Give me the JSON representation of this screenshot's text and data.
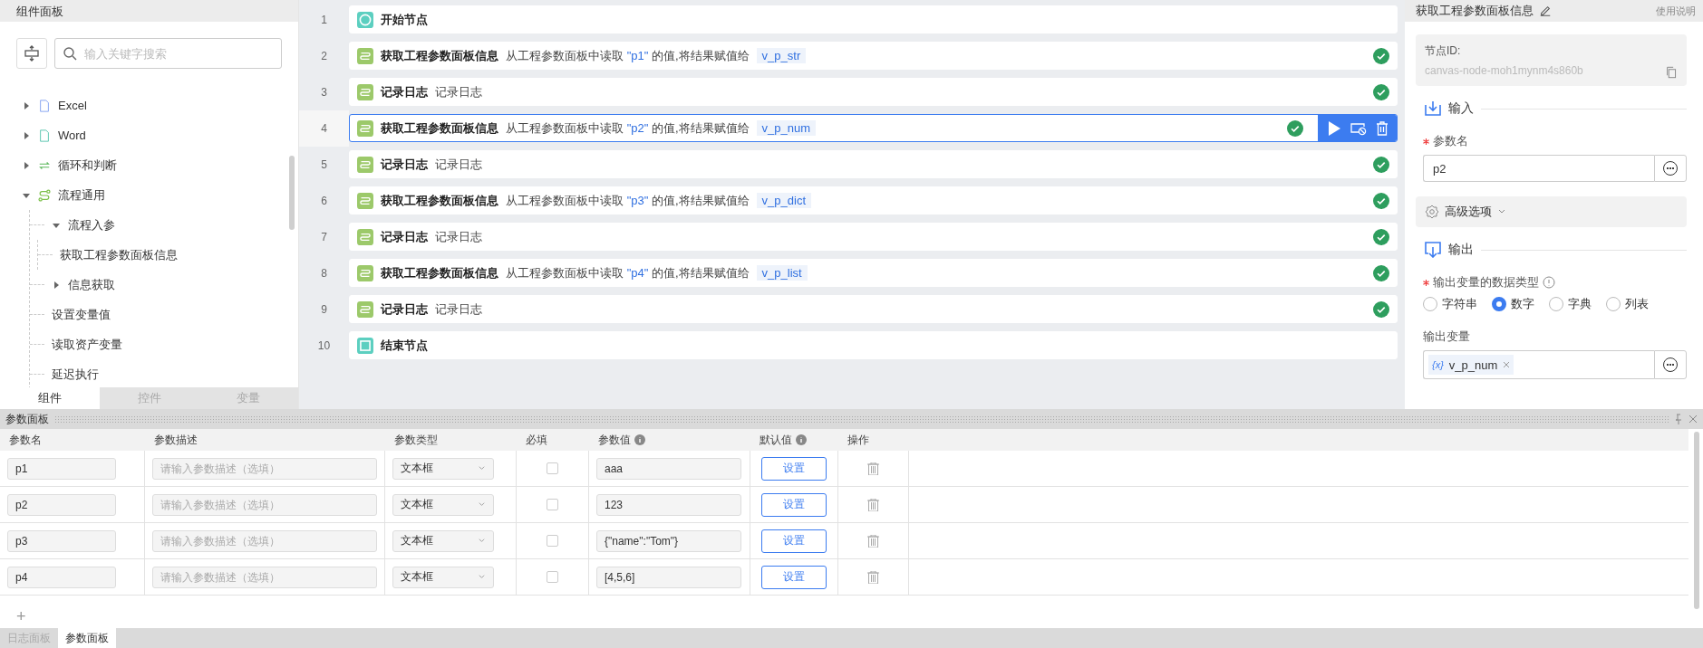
{
  "component_panel": {
    "title": "组件面板",
    "search": {
      "placeholder": "输入关键字搜索"
    },
    "tree": [
      {
        "label": "Excel",
        "kind": "excel",
        "expanded": false
      },
      {
        "label": "Word",
        "kind": "word",
        "expanded": false
      },
      {
        "label": "循环和判断",
        "kind": "loop",
        "expanded": false
      },
      {
        "label": "流程通用",
        "kind": "flow",
        "expanded": true,
        "children": [
          {
            "label": "流程入参",
            "expanded": true,
            "children": [
              {
                "label": "获取工程参数面板信息"
              }
            ]
          },
          {
            "label": "信息获取",
            "expanded": false
          },
          {
            "label": "设置变量值"
          },
          {
            "label": "读取资产变量"
          },
          {
            "label": "延迟执行"
          }
        ]
      }
    ],
    "tabs": [
      {
        "label": "组件",
        "selected": true
      },
      {
        "label": "控件",
        "selected": false
      },
      {
        "label": "变量",
        "selected": false
      }
    ]
  },
  "flow": {
    "nodes": [
      {
        "number": "1",
        "kind": "start",
        "title": "开始节点",
        "selected": false
      },
      {
        "number": "2",
        "kind": "action",
        "title": "获取工程参数面板信息",
        "text": "从工程参数面板中读取",
        "param": "\"p1\"",
        "text_after": "的值,将结果赋值给",
        "variable": "v_p_str",
        "selected": false,
        "done": true
      },
      {
        "number": "3",
        "kind": "action",
        "title": "记录日志",
        "text": "记录日志",
        "selected": false,
        "done": true
      },
      {
        "number": "4",
        "kind": "action",
        "title": "获取工程参数面板信息",
        "text": "从工程参数面板中读取",
        "param": "\"p2\"",
        "text_after": "的值,将结果赋值给",
        "variable": "v_p_num",
        "selected": true,
        "done": true
      },
      {
        "number": "5",
        "kind": "action",
        "title": "记录日志",
        "text": "记录日志",
        "selected": false,
        "done": true
      },
      {
        "number": "6",
        "kind": "action",
        "title": "获取工程参数面板信息",
        "text": "从工程参数面板中读取",
        "param": "\"p3\"",
        "text_after": "的值,将结果赋值给",
        "variable": "v_p_dict",
        "selected": false,
        "done": true
      },
      {
        "number": "7",
        "kind": "action",
        "title": "记录日志",
        "text": "记录日志",
        "selected": false,
        "done": true
      },
      {
        "number": "8",
        "kind": "action",
        "title": "获取工程参数面板信息",
        "text": "从工程参数面板中读取",
        "param": "\"p4\"",
        "text_after": "的值,将结果赋值给",
        "variable": "v_p_list",
        "selected": false,
        "done": true
      },
      {
        "number": "9",
        "kind": "action",
        "title": "记录日志",
        "text": "记录日志",
        "selected": false,
        "done": true
      },
      {
        "number": "10",
        "kind": "end",
        "title": "结束节点",
        "selected": false
      }
    ]
  },
  "properties": {
    "title": "获取工程参数面板信息",
    "help": "使用说明",
    "node_id_label": "节点ID:",
    "node_id": "canvas-node-moh1mynm4s860b",
    "input_section": "输入",
    "param_name_label": "参数名",
    "param_name_required": true,
    "param_name": "p2",
    "advanced": "高级选项",
    "output_section": "输出",
    "type_label": "输出变量的数据类型",
    "type_required": true,
    "types": [
      {
        "label": "字符串",
        "selected": false
      },
      {
        "label": "数字",
        "selected": true
      },
      {
        "label": "字典",
        "selected": false
      },
      {
        "label": "列表",
        "selected": false
      }
    ],
    "output_var_label": "输出变量",
    "output_var_icon": "{x}",
    "output_var": "v_p_num"
  },
  "param_panel": {
    "title": "参数面板",
    "columns": [
      {
        "label": "参数名",
        "info": false
      },
      {
        "label": "参数描述",
        "info": false
      },
      {
        "label": "参数类型",
        "info": false
      },
      {
        "label": "必填",
        "info": false
      },
      {
        "label": "参数值",
        "info": true
      },
      {
        "label": "默认值",
        "info": true
      },
      {
        "label": "操作",
        "info": false
      }
    ],
    "rows": [
      {
        "name": "p1",
        "description_placeholder": "请输入参数描述（选填）",
        "type": "文本框",
        "required": false,
        "value": "aaa",
        "default_button": "设置"
      },
      {
        "name": "p2",
        "description_placeholder": "请输入参数描述（选填）",
        "type": "文本框",
        "required": false,
        "value": "123",
        "default_button": "设置"
      },
      {
        "name": "p3",
        "description_placeholder": "请输入参数描述（选填）",
        "type": "文本框",
        "required": false,
        "value": "{\"name\":\"Tom\"}",
        "default_button": "设置"
      },
      {
        "name": "p4",
        "description_placeholder": "请输入参数描述（选填）",
        "type": "文本框",
        "required": false,
        "value": "[4,5,6]",
        "default_button": "设置"
      }
    ],
    "add_button": "+"
  },
  "bottom_tabs": [
    {
      "label": "日志面板",
      "selected": false
    },
    {
      "label": "参数面板",
      "selected": true
    }
  ]
}
